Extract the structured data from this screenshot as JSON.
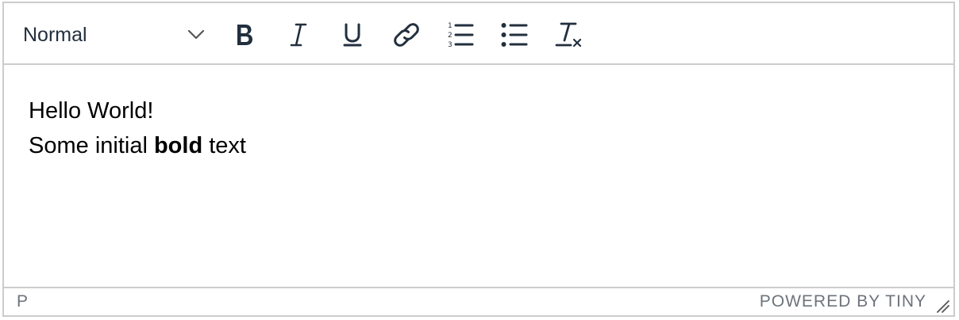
{
  "toolbar": {
    "block_format": "Normal",
    "buttons": [
      {
        "icon": "bold-icon"
      },
      {
        "icon": "italic-icon"
      },
      {
        "icon": "underline-icon"
      },
      {
        "icon": "link-icon"
      },
      {
        "icon": "numbered-list-icon"
      },
      {
        "icon": "bullet-list-icon"
      },
      {
        "icon": "clear-formatting-icon"
      }
    ]
  },
  "content": {
    "line1": "Hello World!",
    "line2_before": "Some initial ",
    "line2_bold": "bold",
    "line2_after": " text"
  },
  "statusbar": {
    "path": "P",
    "branding": "POWERED BY TINY"
  },
  "colors": {
    "icon": "#222f3e",
    "border": "#cccccc",
    "status_text": "#6d737b"
  }
}
